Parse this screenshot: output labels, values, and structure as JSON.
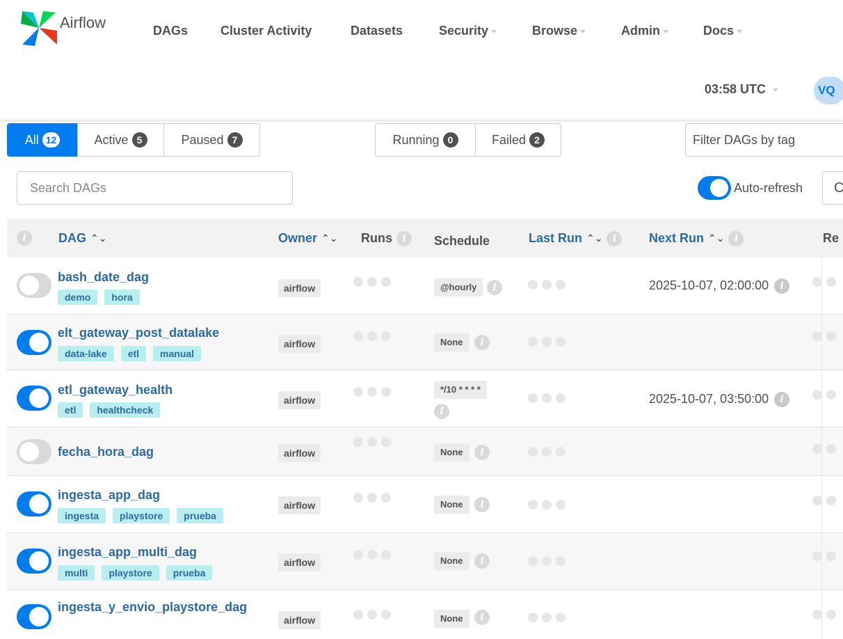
{
  "app": {
    "name": "Airflow"
  },
  "nav": [
    {
      "label": "DAGs",
      "caret": false
    },
    {
      "label": "Cluster Activity",
      "caret": false
    },
    {
      "label": "Datasets",
      "caret": false
    },
    {
      "label": "Security",
      "caret": true
    },
    {
      "label": "Browse",
      "caret": true
    },
    {
      "label": "Admin",
      "caret": true
    },
    {
      "label": "Docs",
      "caret": true
    }
  ],
  "header": {
    "time": "03:58 UTC",
    "user_initials": "VQ"
  },
  "filters": {
    "all": {
      "label": "All",
      "count": "12"
    },
    "active": {
      "label": "Active",
      "count": "5"
    },
    "paused": {
      "label": "Paused",
      "count": "7"
    },
    "running": {
      "label": "Running",
      "count": "0"
    },
    "failed": {
      "label": "Failed",
      "count": "2"
    },
    "tag_placeholder": "Filter DAGs by tag",
    "search_placeholder": "Search DAGs",
    "auto_refresh": "Auto-refresh",
    "refresh_icon": "C"
  },
  "table": {
    "headers": {
      "dag": "DAG",
      "owner": "Owner",
      "runs": "Runs",
      "schedule": "Schedule",
      "last_run": "Last Run",
      "next_run": "Next Run",
      "recent": "Re"
    },
    "rows": [
      {
        "name": "bash_date_dag",
        "enabled": false,
        "tags": [
          "demo",
          "hora"
        ],
        "owner": "airflow",
        "schedule": "@hourly",
        "next_run": "2025-10-07, 02:00:00"
      },
      {
        "name": "elt_gateway_post_datalake",
        "enabled": true,
        "tags": [
          "data-lake",
          "etl",
          "manual"
        ],
        "owner": "airflow",
        "schedule": "None",
        "next_run": ""
      },
      {
        "name": "etl_gateway_health",
        "enabled": true,
        "tags": [
          "etl",
          "healthcheck"
        ],
        "owner": "airflow",
        "schedule": "*/10 * * * *",
        "next_run": "2025-10-07, 03:50:00"
      },
      {
        "name": "fecha_hora_dag",
        "enabled": false,
        "tags": [],
        "owner": "airflow",
        "schedule": "None",
        "next_run": ""
      },
      {
        "name": "ingesta_app_dag",
        "enabled": true,
        "tags": [
          "ingesta",
          "playstore",
          "prueba"
        ],
        "owner": "airflow",
        "schedule": "None",
        "next_run": ""
      },
      {
        "name": "ingesta_app_multi_dag",
        "enabled": true,
        "tags": [
          "multi",
          "playstore",
          "prueba"
        ],
        "owner": "airflow",
        "schedule": "None",
        "next_run": ""
      },
      {
        "name": "ingesta_y_envio_playstore_dag",
        "enabled": true,
        "tags": [],
        "owner": "airflow",
        "schedule": "None",
        "next_run": ""
      }
    ]
  },
  "colors": {
    "primary": "#017cee",
    "link": "#2d6aa1",
    "tag_bg": "#b8eef0"
  }
}
